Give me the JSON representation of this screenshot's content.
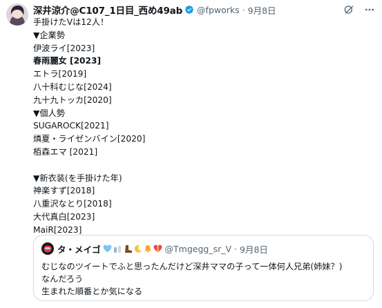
{
  "post": {
    "author_name": "深井涼介@C107_1日目_西め49ab",
    "author_handle": "@fpworks",
    "separator": "·",
    "date": "9月8日",
    "lines": [
      {
        "text": "手掛けたVは12人！",
        "bold": false
      },
      {
        "text": "▼企業勢",
        "bold": false
      },
      {
        "text": "伊波ライ[2023]",
        "bold": false
      },
      {
        "text": "春雨麗女 [2023]",
        "bold": true
      },
      {
        "text": "エトラ[2019]",
        "bold": false
      },
      {
        "text": "八十科むじな[2024]",
        "bold": false
      },
      {
        "text": "九十九トッカ[2020]",
        "bold": false
      },
      {
        "text": "▼個人勢",
        "bold": false
      },
      {
        "text": "SUGAROCK[2021]",
        "bold": false
      },
      {
        "text": "燐夏・ライゼンバイン[2020]",
        "bold": false
      },
      {
        "text": "栢森エマ [2021]",
        "bold": false
      },
      {
        "text": "",
        "bold": false
      },
      {
        "text": "▼新衣装(を手掛けた年)",
        "bold": false
      },
      {
        "text": "神楽すず[2018]",
        "bold": false
      },
      {
        "text": "八重沢なとり[2018]",
        "bold": false
      },
      {
        "text": "大代真白[2023]",
        "bold": false
      },
      {
        "text": "MaiR[2023]",
        "bold": false
      }
    ]
  },
  "quote": {
    "author_name": "タ・メイゴ",
    "author_handle": "@Tmgegg_sr_V",
    "separator": "·",
    "date": "9月8日",
    "lines": [
      "むじなのツイートでふと思ったんだけど深井ママの子って一体何人兄弟(姉妹？)",
      "なんだろう",
      "生まれた順番とか気になる"
    ]
  },
  "icons": {
    "verified": "verified-badge-icon",
    "grok": "grok-icon",
    "more": "more-icon"
  },
  "colors": {
    "verified": "#1d9bf0",
    "secondary_text": "#536471",
    "border": "#cfd9de"
  }
}
